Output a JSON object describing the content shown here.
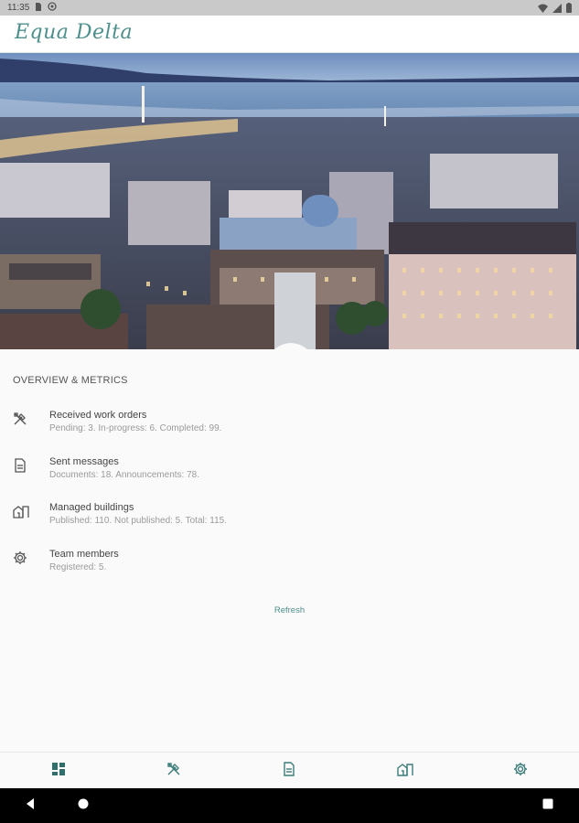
{
  "status_bar": {
    "time": "11:35",
    "icons": [
      "sim-card-icon",
      "at-sign-icon",
      "wifi-icon",
      "signal-icon",
      "battery-icon"
    ]
  },
  "app": {
    "logo_text": "Equa Delta",
    "accent_color": "#4e8f8c"
  },
  "overview": {
    "title": "OVERVIEW & METRICS",
    "items": [
      {
        "icon": "tools-icon",
        "title": "Received work orders",
        "desc": "Pending: 3. In-progress: 6. Completed: 99."
      },
      {
        "icon": "document-icon",
        "title": "Sent messages",
        "desc": "Documents: 18. Announcements: 78."
      },
      {
        "icon": "buildings-icon",
        "title": "Managed buildings",
        "desc": "Published: 110. Not published: 5. Total: 115."
      },
      {
        "icon": "gear-icon",
        "title": "Team members",
        "desc": "Registered: 5."
      }
    ],
    "refresh_label": "Refresh"
  },
  "bottom_nav": {
    "items": [
      "dashboard-icon",
      "tools-icon",
      "document-icon",
      "buildings-icon",
      "gear-icon"
    ],
    "active": 0
  },
  "system_nav": {
    "items": [
      "back-icon",
      "home-icon",
      "recents-icon"
    ]
  }
}
